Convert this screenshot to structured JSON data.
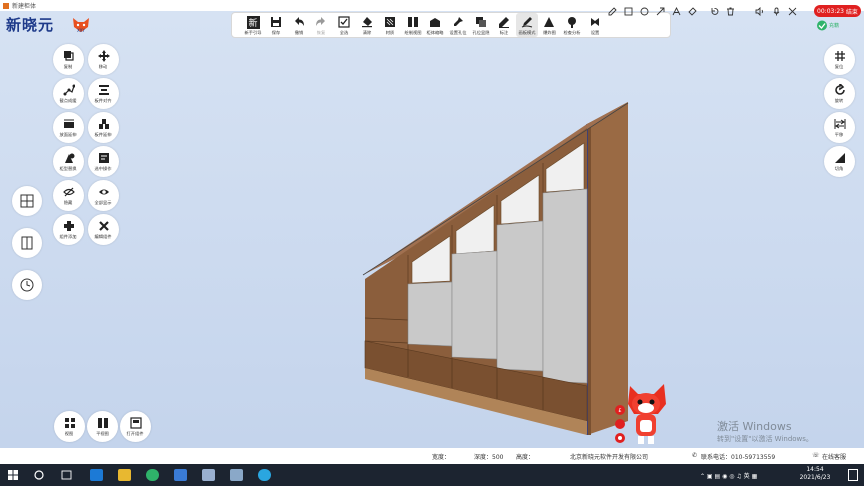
{
  "window": {
    "title": "新建柜体"
  },
  "logo": {
    "text": "新晓元",
    "badge": "XXY"
  },
  "toolbar": {
    "items": [
      {
        "label": "新手引导",
        "icon": "new-guide-icon",
        "glyph": "新"
      },
      {
        "label": "保存",
        "icon": "save-icon"
      },
      {
        "label": "撤销",
        "icon": "undo-icon"
      },
      {
        "label": "恢复",
        "icon": "redo-icon"
      },
      {
        "label": "全选",
        "icon": "select-all-icon"
      },
      {
        "label": "清除",
        "icon": "eraser-icon"
      },
      {
        "label": "材质",
        "icon": "material-icon"
      },
      {
        "label": "绘制视图",
        "icon": "draw-view-icon"
      },
      {
        "label": "柜体缩略",
        "icon": "cabinet-thumbnail-icon"
      },
      {
        "label": "设置孔位",
        "icon": "set-hole-icon"
      },
      {
        "label": "孔位显隐",
        "icon": "hole-visibility-icon"
      },
      {
        "label": "标注",
        "icon": "annotate-icon"
      },
      {
        "label": "画板模式",
        "icon": "drawing-board-icon"
      },
      {
        "label": "爆炸图",
        "icon": "explode-icon"
      },
      {
        "label": "检查分析",
        "icon": "check-analysis-icon"
      },
      {
        "label": "设置",
        "icon": "settings-icon"
      }
    ]
  },
  "draw_tools": [
    {
      "icon": "pencil-icon"
    },
    {
      "icon": "square-icon"
    },
    {
      "icon": "circle-icon"
    },
    {
      "icon": "arrow-icon"
    },
    {
      "icon": "text-icon"
    },
    {
      "icon": "highlighter-icon"
    },
    {
      "icon": "rotate-icon"
    },
    {
      "icon": "trash-icon"
    },
    {
      "icon": "speaker-icon"
    },
    {
      "icon": "microphone-icon"
    },
    {
      "icon": "close-icon"
    }
  ],
  "recording": {
    "time": "00:03:23",
    "action": "结束"
  },
  "login": {
    "label": "充籍"
  },
  "left_tools": [
    {
      "label": "复制",
      "icon": "copy-icon"
    },
    {
      "label": "移动",
      "icon": "move-icon"
    },
    {
      "label": "截点成缓",
      "icon": "node-icon"
    },
    {
      "label": "板件对齐",
      "icon": "align-icon"
    },
    {
      "label": "放面延伸",
      "icon": "extend-face-icon"
    },
    {
      "label": "板件延伸",
      "icon": "board-extend-icon"
    },
    {
      "label": "柜型替换",
      "icon": "replace-icon"
    },
    {
      "label": "选中操作",
      "icon": "select-operate-icon"
    },
    {
      "label": "隐藏",
      "icon": "hide-icon"
    },
    {
      "label": "全部显示",
      "icon": "show-all-icon"
    },
    {
      "label": "组件添加",
      "icon": "component-add-icon"
    },
    {
      "label": "编辑组件",
      "icon": "component-edit-icon"
    }
  ],
  "side_buttons": [
    {
      "icon": "layout-icon"
    },
    {
      "icon": "panel-split-icon"
    },
    {
      "icon": "history-clock-icon"
    }
  ],
  "right_tools": [
    {
      "label": "复位",
      "icon": "reset-icon"
    },
    {
      "label": "旋转",
      "icon": "rotate-view-icon"
    },
    {
      "label": "平移",
      "icon": "pan-icon"
    },
    {
      "label": "切角",
      "icon": "chamfer-icon"
    }
  ],
  "bottom_tools": [
    {
      "label": "视图",
      "icon": "view-icon"
    },
    {
      "label": "平视图",
      "icon": "flat-view-icon"
    },
    {
      "label": "打开组件",
      "icon": "open-component-icon"
    }
  ],
  "status": {
    "width_label": "宽度：",
    "depth_label": "深度：500",
    "height_label": "高度：",
    "company": "北京新晓元软件开发有限公司",
    "phone": "联系电话：010-59713559",
    "online": "在线客服"
  },
  "watermark": {
    "line1": "激活 Windows",
    "line2": "转到\"设置\"以激活 Windows。"
  },
  "taskbar": {
    "time": "14:54",
    "date": "2021/6/23"
  },
  "colors": {
    "accent": "#1e3a8a",
    "record": "#e02020",
    "wood": "#8b5e3c",
    "panel": "#c9c9c9"
  }
}
